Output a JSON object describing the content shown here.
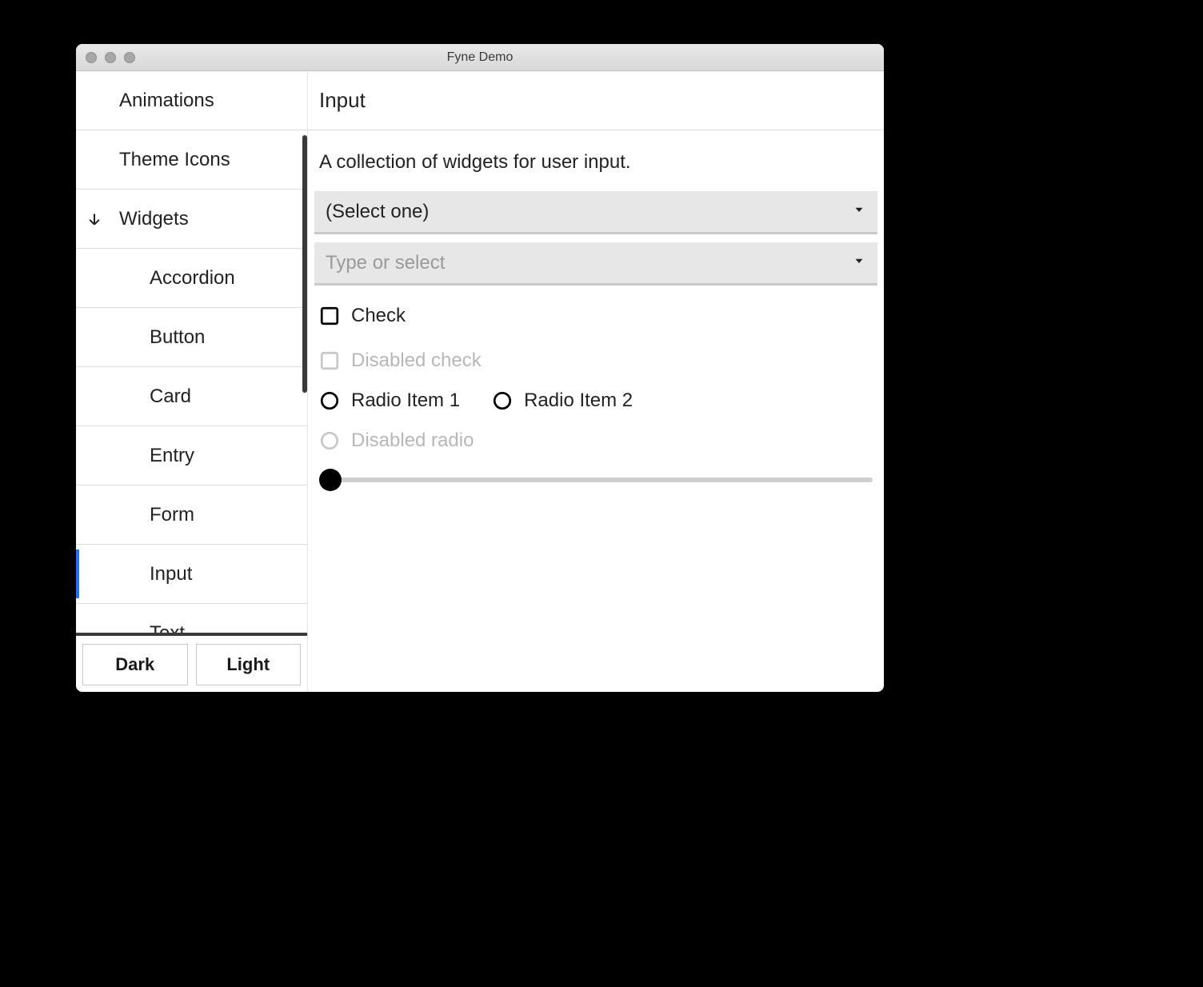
{
  "window": {
    "title": "Fyne Demo"
  },
  "sidebar": {
    "items": [
      {
        "label": "Animations",
        "indent": 0
      },
      {
        "label": "Theme Icons",
        "indent": 0
      },
      {
        "label": "Widgets",
        "indent": 0,
        "expanded": true
      },
      {
        "label": "Accordion",
        "indent": 1
      },
      {
        "label": "Button",
        "indent": 1
      },
      {
        "label": "Card",
        "indent": 1
      },
      {
        "label": "Entry",
        "indent": 1
      },
      {
        "label": "Form",
        "indent": 1
      },
      {
        "label": "Input",
        "indent": 1,
        "selected": true
      },
      {
        "label": "Text",
        "indent": 1
      }
    ],
    "theme_buttons": {
      "dark": "Dark",
      "light": "Light"
    }
  },
  "main": {
    "title": "Input",
    "description": "A collection of widgets for user input.",
    "select": {
      "placeholder": "(Select one)"
    },
    "combo": {
      "placeholder": "Type or select"
    },
    "check": {
      "label": "Check",
      "checked": false
    },
    "disabled_check": {
      "label": "Disabled check"
    },
    "radio": {
      "items": [
        "Radio Item 1",
        "Radio Item 2"
      ]
    },
    "disabled_radio": {
      "label": "Disabled radio"
    },
    "slider": {
      "value": 0,
      "min": 0,
      "max": 100
    }
  }
}
